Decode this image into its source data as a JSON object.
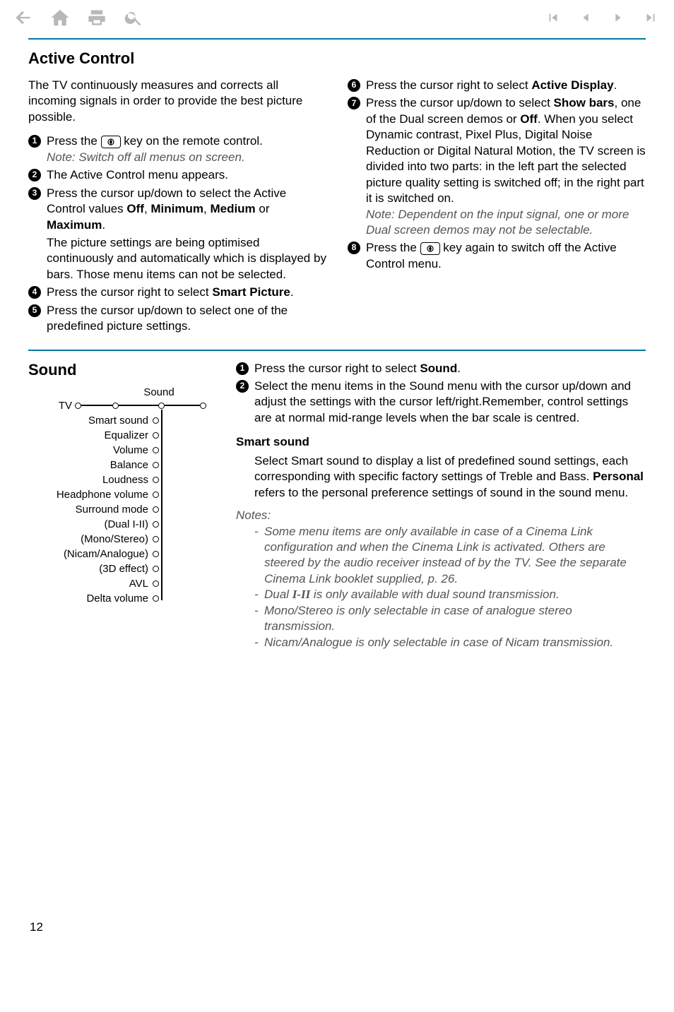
{
  "toolbar": {
    "icons": [
      "back",
      "home",
      "print",
      "search",
      "first",
      "prev",
      "next",
      "last"
    ]
  },
  "section1": {
    "title": "Active Control",
    "intro": "The TV continuously measures and corrects all incoming signals in order to provide the best picture possible.",
    "steps_left": [
      {
        "n": "1",
        "pre": "Press the ",
        "post": " key on the remote control.",
        "note": "Note: Switch off all menus on screen."
      },
      {
        "n": "2",
        "text": "The Active Control menu appears."
      },
      {
        "n": "3",
        "text_a": "Press the cursor up/down to select the Active Control values ",
        "b1": "Off",
        "sep1": ", ",
        "b2": "Minimum",
        "sep2": ", ",
        "b3": "Medium",
        "sep3": " or ",
        "b4": "Maximum",
        "post": ".",
        "tail": "The picture settings are being optimised continuously and automatically which is displayed by bars. Those menu items can not be selected."
      },
      {
        "n": "4",
        "text_a": "Press the cursor right to select ",
        "b1": "Smart Picture",
        "post": "."
      },
      {
        "n": "5",
        "text": "Press the cursor up/down to select one of the predefined picture settings."
      }
    ],
    "steps_right": [
      {
        "n": "6",
        "text_a": "Press the cursor right to select ",
        "b1": "Active Display",
        "post": "."
      },
      {
        "n": "7",
        "text_a": "Press the cursor up/down to select ",
        "b1": "Show bars",
        "mid": ", one of the Dual screen demos or ",
        "b2": "Off",
        "post": ". When you select Dynamic contrast, Pixel Plus, Digital Noise Reduction or Digital Natural Motion, the TV screen is divided into two parts: in the left part the selected picture quality setting is switched off; in the right part it is switched on.",
        "note": "Note: Dependent on the input signal, one or more Dual screen demos may not be selectable."
      },
      {
        "n": "8",
        "pre": "Press the ",
        "post": " key again to switch off the Active Control menu."
      }
    ]
  },
  "section2": {
    "title": "Sound",
    "diagram": {
      "header": "Sound",
      "root": "TV",
      "items": [
        "Smart sound",
        "Equalizer",
        "Volume",
        "Balance",
        "Loudness",
        "Headphone volume",
        "Surround mode",
        "(Dual I-II)",
        "(Mono/Stereo)",
        "(Nicam/Analogue)",
        "(3D effect)",
        "AVL",
        "Delta volume"
      ]
    },
    "steps": [
      {
        "n": "1",
        "text_a": "Press the cursor right to select ",
        "b1": "Sound",
        "post": "."
      },
      {
        "n": "2",
        "text": "Select the menu items in the Sound menu with the cursor up/down and adjust the settings with the cursor left/right.Remember, control settings are at normal mid-range levels when the bar scale is centred."
      }
    ],
    "smart_title": "Smart sound",
    "smart_text_a": "Select Smart sound to display a list of predefined sound settings, each corresponding with specific factory settings of Treble and Bass. ",
    "smart_b": "Personal",
    "smart_text_b": " refers to the personal preference settings of sound in the sound menu.",
    "notes_title": "Notes:",
    "notes": [
      "Some menu items are only available in case of a Cinema Link configuration and when the Cinema Link is activated. Others are steered by the audio receiver instead of by the TV. See the separate Cinema Link booklet supplied, p. 26.",
      "Dual |DUAL_ICON| is only available with dual sound transmission.",
      "Mono/Stereo is only selectable in case of analogue stereo transmission.",
      "Nicam/Analogue is only selectable in case of Nicam transmission."
    ]
  },
  "page_number": "12"
}
